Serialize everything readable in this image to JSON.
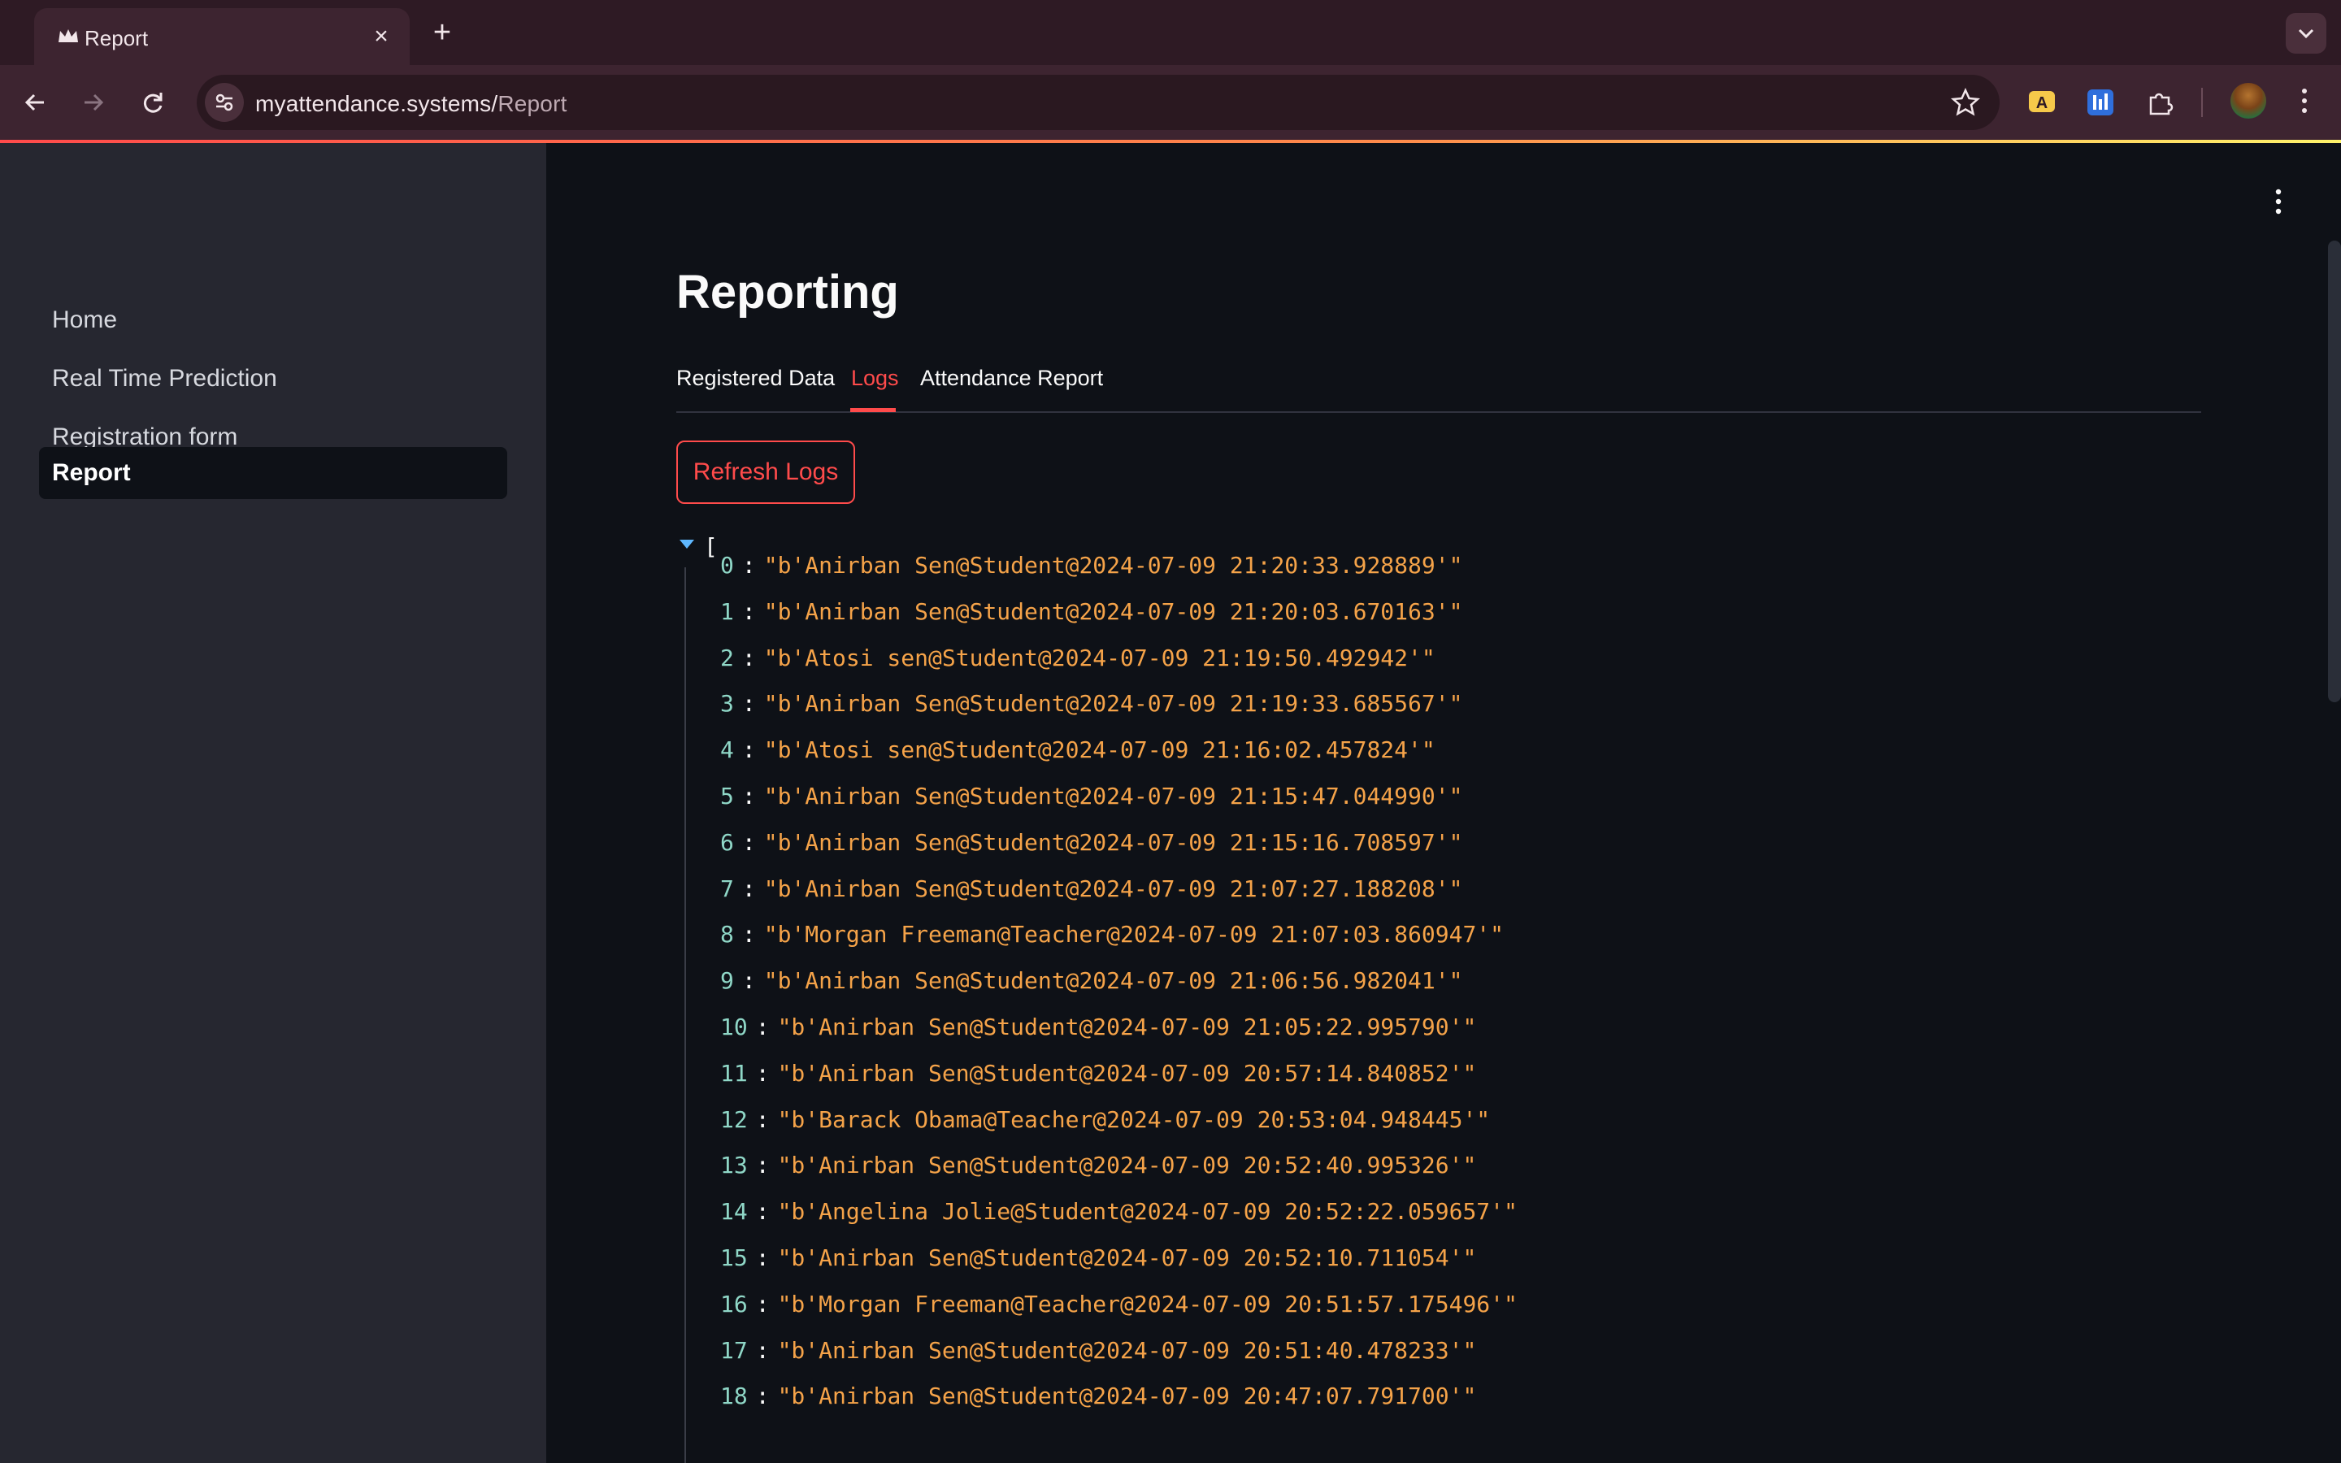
{
  "browser": {
    "tab_title": "Report",
    "tab_close": "×",
    "new_tab": "+",
    "url_host": "myattendance.systems/",
    "url_path": "Report"
  },
  "sidebar": {
    "items": [
      {
        "label": "Home"
      },
      {
        "label": "Real Time Prediction"
      },
      {
        "label": "Registration form"
      },
      {
        "label": "Report",
        "active": true
      }
    ]
  },
  "main": {
    "title": "Reporting",
    "tabs": [
      {
        "label": "Registered Data"
      },
      {
        "label": "Logs",
        "active": true
      },
      {
        "label": "Attendance Report"
      }
    ],
    "refresh_button": "Refresh Logs",
    "json_open": "[",
    "logs": [
      {
        "index": "0",
        "value": "\"b'Anirban Sen@Student@2024-07-09 21:20:33.928889'\""
      },
      {
        "index": "1",
        "value": "\"b'Anirban Sen@Student@2024-07-09 21:20:03.670163'\""
      },
      {
        "index": "2",
        "value": "\"b'Atosi sen@Student@2024-07-09 21:19:50.492942'\""
      },
      {
        "index": "3",
        "value": "\"b'Anirban Sen@Student@2024-07-09 21:19:33.685567'\""
      },
      {
        "index": "4",
        "value": "\"b'Atosi sen@Student@2024-07-09 21:16:02.457824'\""
      },
      {
        "index": "5",
        "value": "\"b'Anirban Sen@Student@2024-07-09 21:15:47.044990'\""
      },
      {
        "index": "6",
        "value": "\"b'Anirban Sen@Student@2024-07-09 21:15:16.708597'\""
      },
      {
        "index": "7",
        "value": "\"b'Anirban Sen@Student@2024-07-09 21:07:27.188208'\""
      },
      {
        "index": "8",
        "value": "\"b'Morgan Freeman@Teacher@2024-07-09 21:07:03.860947'\""
      },
      {
        "index": "9",
        "value": "\"b'Anirban Sen@Student@2024-07-09 21:06:56.982041'\""
      },
      {
        "index": "10",
        "value": "\"b'Anirban Sen@Student@2024-07-09 21:05:22.995790'\""
      },
      {
        "index": "11",
        "value": "\"b'Anirban Sen@Student@2024-07-09 20:57:14.840852'\""
      },
      {
        "index": "12",
        "value": "\"b'Barack Obama@Teacher@2024-07-09 20:53:04.948445'\""
      },
      {
        "index": "13",
        "value": "\"b'Anirban Sen@Student@2024-07-09 20:52:40.995326'\""
      },
      {
        "index": "14",
        "value": "\"b'Angelina Jolie@Student@2024-07-09 20:52:22.059657'\""
      },
      {
        "index": "15",
        "value": "\"b'Anirban Sen@Student@2024-07-09 20:52:10.711054'\""
      },
      {
        "index": "16",
        "value": "\"b'Morgan Freeman@Teacher@2024-07-09 20:51:57.175496'\""
      },
      {
        "index": "17",
        "value": "\"b'Anirban Sen@Student@2024-07-09 20:51:40.478233'\""
      },
      {
        "index": "18",
        "value": "\"b'Anirban Sen@Student@2024-07-09 20:47:07.791700'\""
      }
    ]
  },
  "colors": {
    "accent": "#ff4b4b",
    "sidebar_bg": "#262730",
    "main_bg": "#0e1117",
    "json_string": "#f5a349",
    "json_index": "#8fd7c7"
  }
}
